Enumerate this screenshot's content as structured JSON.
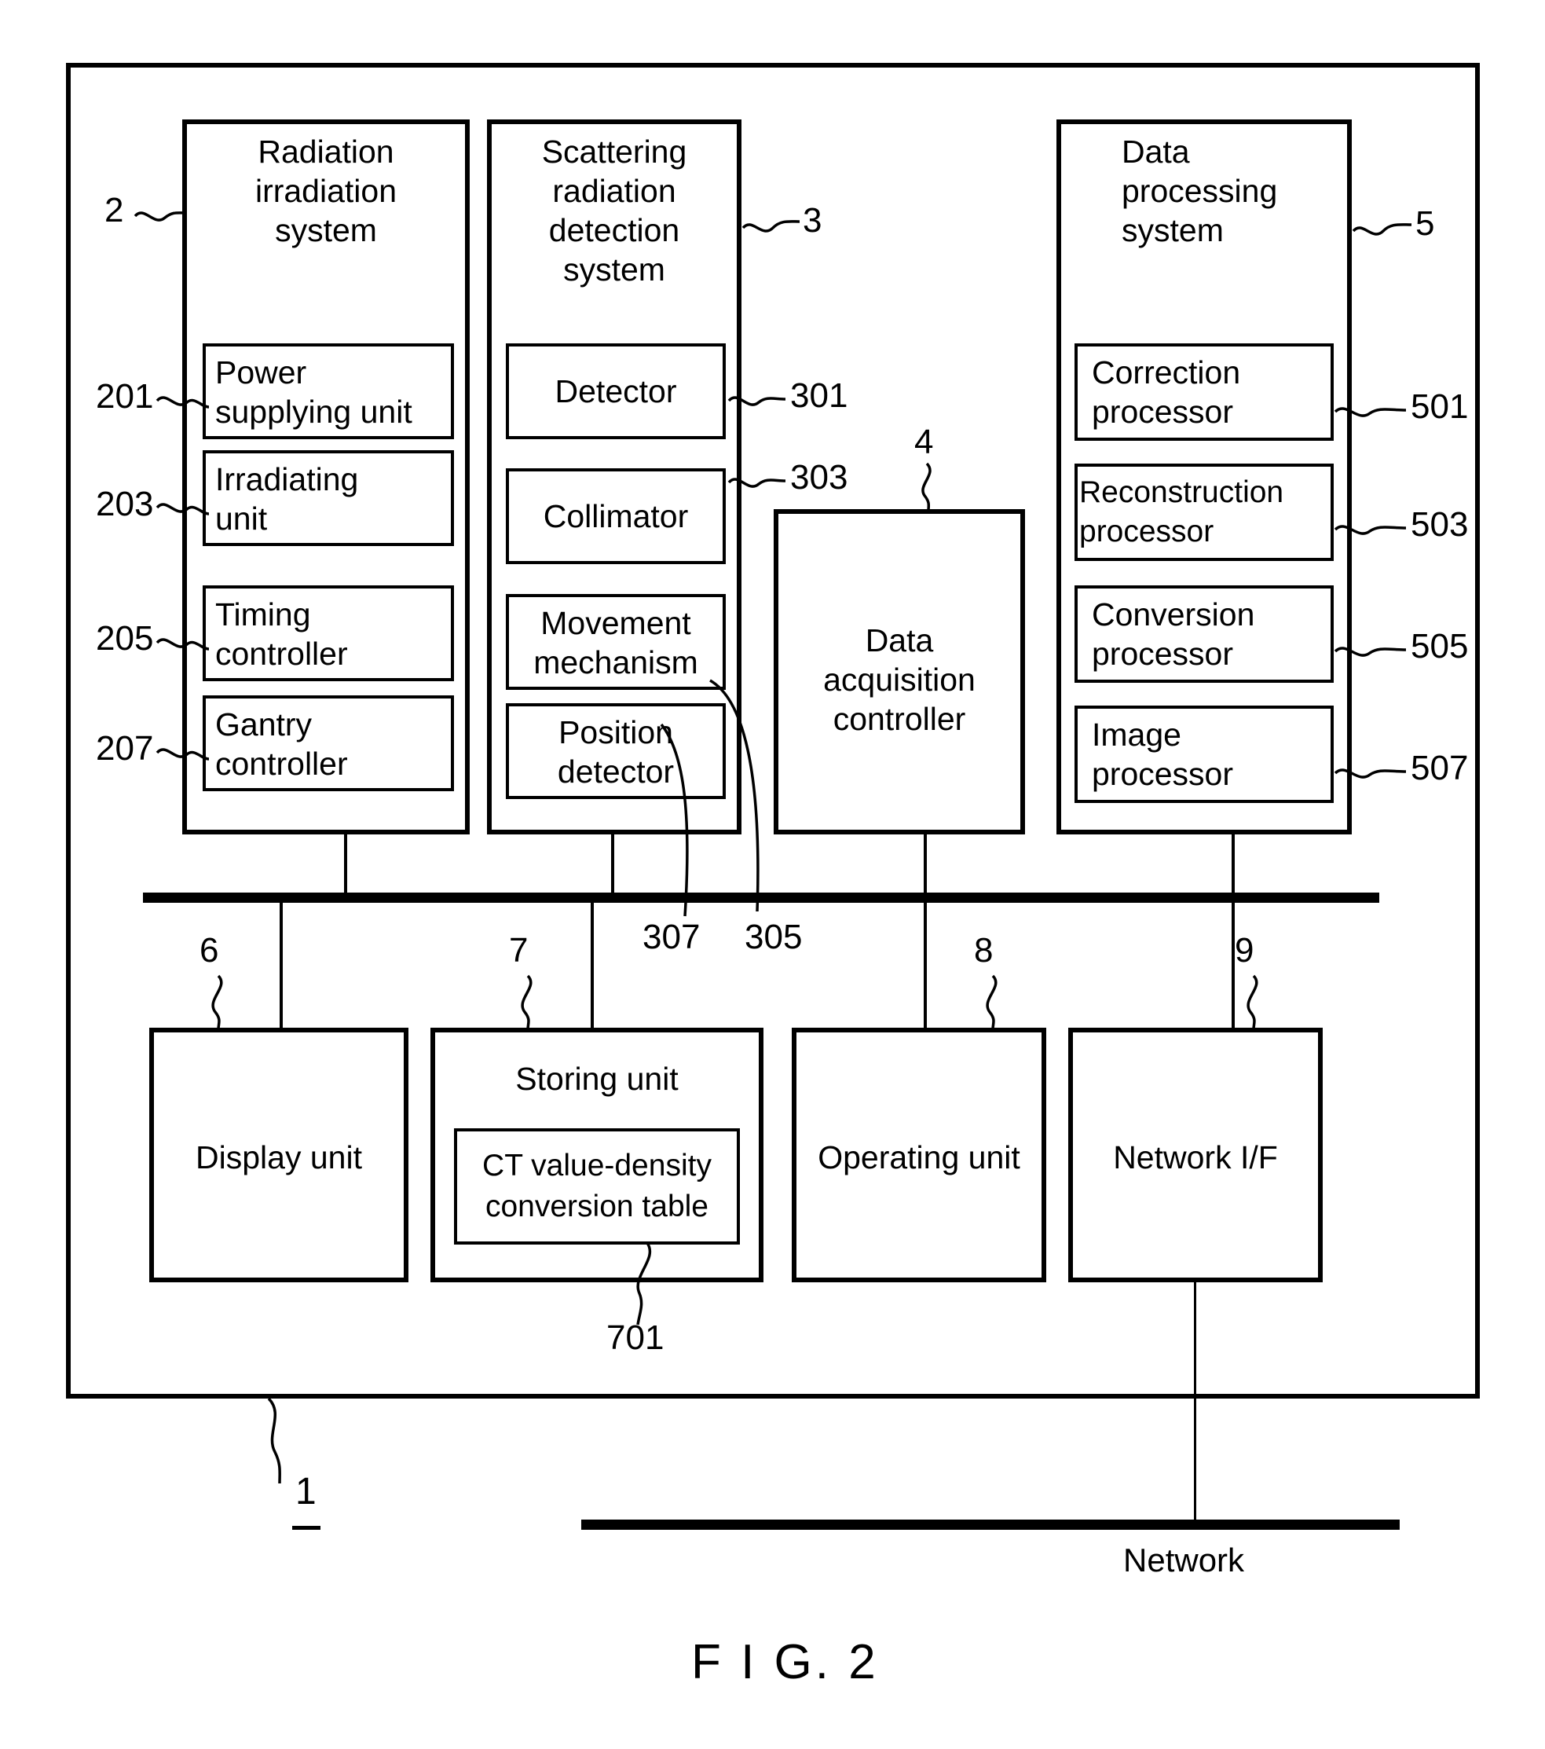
{
  "figure": {
    "caption": "F I G. 2",
    "apparatus_ref": "1",
    "network_label": "Network"
  },
  "systems": [
    {
      "ref": "2",
      "title": "Radiation\nirradiation\nsystem",
      "children": [
        {
          "ref": "201",
          "label": "Power\nsupplying unit"
        },
        {
          "ref": "203",
          "label": "Irradiating\nunit"
        },
        {
          "ref": "205",
          "label": "Timing\ncontroller"
        },
        {
          "ref": "207",
          "label": "Gantry\ncontroller"
        }
      ]
    },
    {
      "ref": "3",
      "title": "Scattering\nradiation\ndetection\nsystem",
      "children": [
        {
          "ref": "301",
          "label": "Detector"
        },
        {
          "ref": "303",
          "label": "Collimator"
        },
        {
          "ref": "305",
          "label": "Movement\nmechanism"
        },
        {
          "ref": "307",
          "label": "Position\ndetector"
        }
      ]
    },
    {
      "ref": "5",
      "title": "Data\nprocessing\nsystem",
      "children": [
        {
          "ref": "501",
          "label": "Correction\nprocessor"
        },
        {
          "ref": "503",
          "label": "Reconstruction\nprocessor"
        },
        {
          "ref": "505",
          "label": "Conversion\nprocessor"
        },
        {
          "ref": "507",
          "label": "Image\nprocessor"
        }
      ]
    }
  ],
  "acquisition": {
    "ref": "4",
    "label": "Data\nacquisition\ncontroller"
  },
  "peripherals": [
    {
      "ref": "6",
      "label": "Display unit"
    },
    {
      "ref": "7",
      "label": "Storing unit",
      "child": {
        "ref": "701",
        "label": "CT value-density\nconversion table"
      }
    },
    {
      "ref": "8",
      "label": "Operating unit"
    },
    {
      "ref": "9",
      "label": "Network I/F"
    }
  ],
  "colors": {
    "ink": "#000000",
    "paper": "#ffffff"
  }
}
